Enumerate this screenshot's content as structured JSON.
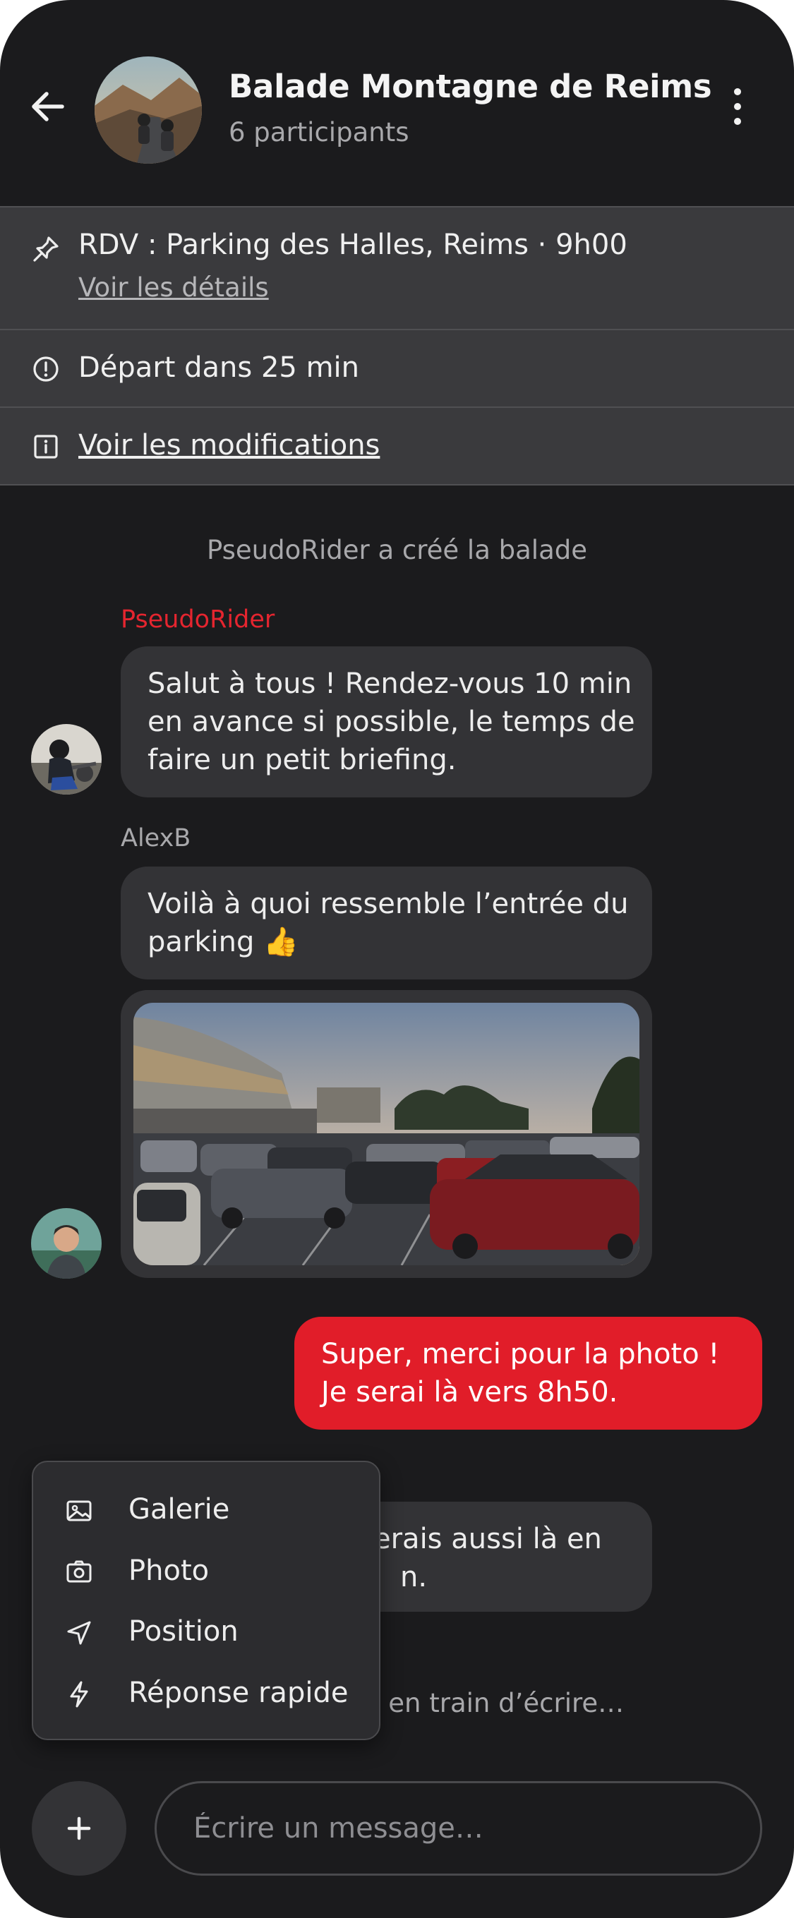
{
  "header": {
    "back_icon": "arrow-left-icon",
    "group_avatar": "motorcycle-road-photo",
    "title": "Balade Montagne de Reims",
    "subtitle": "6 participants",
    "more_icon": "more-vertical-icon"
  },
  "banners": {
    "rdv": {
      "icon": "pin-icon",
      "text": "RDV : Parking des Halles, Reims · 9h00",
      "link": "Voir les détails"
    },
    "depart": {
      "icon": "alert-circle-icon",
      "text": "Départ dans 25 min"
    },
    "modifications": {
      "icon": "info-square-icon",
      "text": "Voir les modifications"
    }
  },
  "chat": {
    "system_message": "PseudoRider a créé la balade",
    "messages": [
      {
        "sender": "PseudoRider",
        "lines": [
          "Salut à tous ! Rendez-vous 10 min",
          "en avance si possible, le temps de",
          "faire un petit briefing."
        ]
      },
      {
        "sender": "AlexB",
        "lines": [
          "Voilà à quoi ressemble l’entrée du",
          "parking 👍"
        ],
        "image": "parking-photo"
      },
      {
        "sender": "me",
        "lines": [
          "Super, merci pour la photo !",
          "Je serai là vers 8h50."
        ]
      },
      {
        "sender": "",
        "lines": [
          "erais aussi là en",
          "n."
        ]
      }
    ],
    "typing_indicator": "t en train d’écrire…"
  },
  "attach_menu": {
    "items": [
      {
        "label": "Galerie",
        "icon": "image-icon"
      },
      {
        "label": "Photo",
        "icon": "camera-icon"
      },
      {
        "label": "Position",
        "icon": "navigation-icon"
      },
      {
        "label": "Réponse rapide",
        "icon": "lightning-icon"
      }
    ]
  },
  "composer": {
    "plus_icon": "plus-icon",
    "placeholder": "Écrire un message…"
  },
  "colors": {
    "background": "#1B1B1D",
    "banner": "#3A3A3D",
    "bubble_in": "#333336",
    "bubble_out": "#E11D29",
    "accent_name": "#E5252F"
  }
}
